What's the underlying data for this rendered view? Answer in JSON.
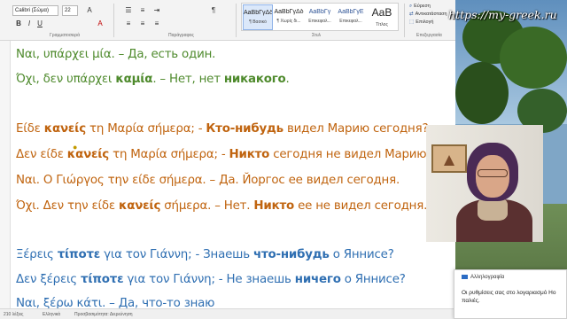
{
  "ribbon": {
    "font_name": "Calibri (Σώμα)",
    "font_size": "22",
    "format_buttons": [
      "B",
      "I",
      "U"
    ],
    "group_labels": {
      "font": "Γραμματοσειρά",
      "paragraph": "Παράγραφος",
      "styles": "Στυλ",
      "editing": "Επεξεργασία"
    },
    "styles": [
      {
        "sample": "AaBbΓγΔδ",
        "name": "¶ Βασικό"
      },
      {
        "sample": "AaBbΓγΔδ",
        "name": "¶ Χωρίς δι..."
      },
      {
        "sample": "AaBbΓγ",
        "name": "Επικεφαλ..."
      },
      {
        "sample": "AaBbΓγΕ",
        "name": "Επικεφαλ..."
      },
      {
        "sample": "AaB",
        "name": "Τίτλος"
      }
    ],
    "editing": {
      "find": "Εύρεση",
      "replace": "Αντικατάσταση",
      "select": "Επιλογή"
    }
  },
  "document": {
    "lines": [
      {
        "parts": [
          {
            "t": "Ναι, υπάρχει μία. – Да, есть один.",
            "c": "green",
            "b": false
          }
        ]
      },
      {
        "parts": [
          {
            "t": "Όχι, δεν υπάρχει ",
            "c": "green",
            "b": false
          },
          {
            "t": "καμία",
            "c": "green",
            "b": true
          },
          {
            "t": ". – Нет, нет ",
            "c": "green",
            "b": false
          },
          {
            "t": "никакого",
            "c": "green",
            "b": true
          },
          {
            "t": ".",
            "c": "green",
            "b": false
          }
        ]
      },
      {
        "parts": [
          {
            "t": "Είδε ",
            "c": "orange",
            "b": false
          },
          {
            "t": "κανείς",
            "c": "orange",
            "b": true
          },
          {
            "t": " τη Μαρία σήμερα; - ",
            "c": "orange",
            "b": false
          },
          {
            "t": "Кто-нибудь",
            "c": "orange",
            "b": true
          },
          {
            "t": " видел Марию сегодня?",
            "c": "orange",
            "b": false
          }
        ]
      },
      {
        "parts": [
          {
            "t": "Δεν είδε ",
            "c": "orange",
            "b": false
          },
          {
            "t": "κανείς",
            "c": "orange",
            "b": true
          },
          {
            "t": " τη Μαρία σήμερα; - ",
            "c": "orange",
            "b": false
          },
          {
            "t": "Никто",
            "c": "orange",
            "b": true
          },
          {
            "t": " сегодня не видел Марию?",
            "c": "orange",
            "b": false
          }
        ]
      },
      {
        "parts": [
          {
            "t": "Ναι. Ο Γιώργος την είδε σήμερα. – Да. Йоргос ее видел сегодня.",
            "c": "orange",
            "b": false
          }
        ]
      },
      {
        "parts": [
          {
            "t": "Όχι. Δεν την είδε ",
            "c": "orange",
            "b": false
          },
          {
            "t": "κανείς",
            "c": "orange",
            "b": true
          },
          {
            "t": " σήμερα. – Нет. ",
            "c": "orange",
            "b": false
          },
          {
            "t": "Никто",
            "c": "orange",
            "b": true
          },
          {
            "t": " ее не видел сегодня.",
            "c": "orange",
            "b": false
          }
        ]
      },
      {
        "parts": [
          {
            "t": "Ξέρεις ",
            "c": "blue",
            "b": false
          },
          {
            "t": "τίποτε",
            "c": "blue",
            "b": true
          },
          {
            "t": " για τον Γιάννη; - Знаешь ",
            "c": "blue",
            "b": false
          },
          {
            "t": "что-нибудь",
            "c": "blue",
            "b": true
          },
          {
            "t": " о Яннисе?",
            "c": "blue",
            "b": false
          }
        ]
      },
      {
        "parts": [
          {
            "t": "Δεν ξέρεις ",
            "c": "blue",
            "b": false
          },
          {
            "t": "τίποτε",
            "c": "blue",
            "b": true
          },
          {
            "t": " για τον Γιάννη; - Не знаешь ",
            "c": "blue",
            "b": false
          },
          {
            "t": "ничего",
            "c": "blue",
            "b": true
          },
          {
            "t": " о Яннисе?",
            "c": "blue",
            "b": false
          }
        ]
      },
      {
        "parts": [
          {
            "t": "Ναι, ξέρω κάτι. – Да, что-то знаю",
            "c": "blue",
            "b": false
          }
        ]
      }
    ]
  },
  "statusbar": {
    "words": "210 λέξεις",
    "language": "Ελληνικά",
    "accessibility": "Προσβασιμότητα: Διερεύνηση"
  },
  "watermark": "https://my-greek.ru",
  "notification": {
    "app": "Αλληλογραφία",
    "text": "Οι ρυθμίσεις σας στο λογαριασμό Ho παλιές."
  },
  "colors": {
    "green": "#4e8a2c",
    "orange": "#c0640f",
    "blue": "#2f6fb2",
    "ribbon_bg": "#f3f3f3"
  }
}
